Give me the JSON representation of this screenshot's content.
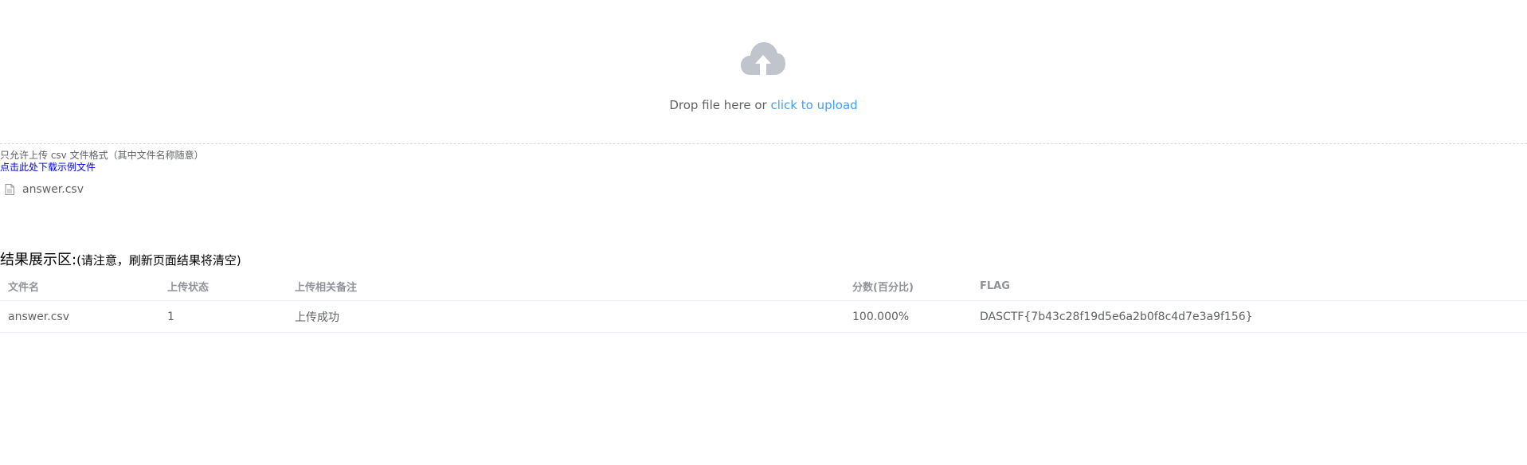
{
  "upload": {
    "drop_text": "Drop file here or ",
    "click_link": "click to upload",
    "icon": "cloud-upload-icon",
    "tip": "只允许上传 csv 文件格式（其中文件名称随意）",
    "download_link": "点击此处下载示例文件"
  },
  "file_list": [
    {
      "name": "answer.csv",
      "icon": "document-icon"
    }
  ],
  "results": {
    "title": "结果展示区:",
    "note": "(请注意，刷新页面结果将清空)",
    "columns": [
      "文件名",
      "上传状态",
      "上传相关备注",
      "分数(百分比)",
      "FLAG"
    ],
    "rows": [
      [
        "answer.csv",
        "1",
        "上传成功",
        "100.000%",
        "DASCTF{7b43c28f19d5e6a2b0f8c4d7e3a9f156}"
      ]
    ]
  },
  "colors": {
    "link": "#409eff",
    "download_link": "#0000ee",
    "text": "#606266",
    "header_text": "#909399",
    "icon": "#c0c4cc",
    "border": "#ebeef5"
  }
}
